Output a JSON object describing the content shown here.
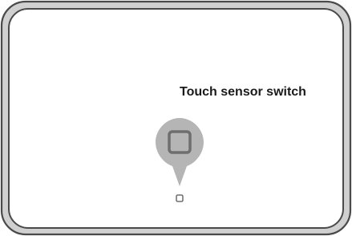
{
  "diagram": {
    "label": "Touch sensor switch"
  },
  "colors": {
    "outer_frame": "#d0d0d0",
    "frame_outline": "#4a4a4a",
    "panel_fill": "#ffffff",
    "callout_fill": "#b5b5b5",
    "callout_icon": "#6e6e6e",
    "switch_outline": "#555555"
  },
  "icons": {
    "callout": "map-pin-callout-icon",
    "magnified_switch": "square-button-icon",
    "sensor_switch": "small-square-switch-icon"
  }
}
